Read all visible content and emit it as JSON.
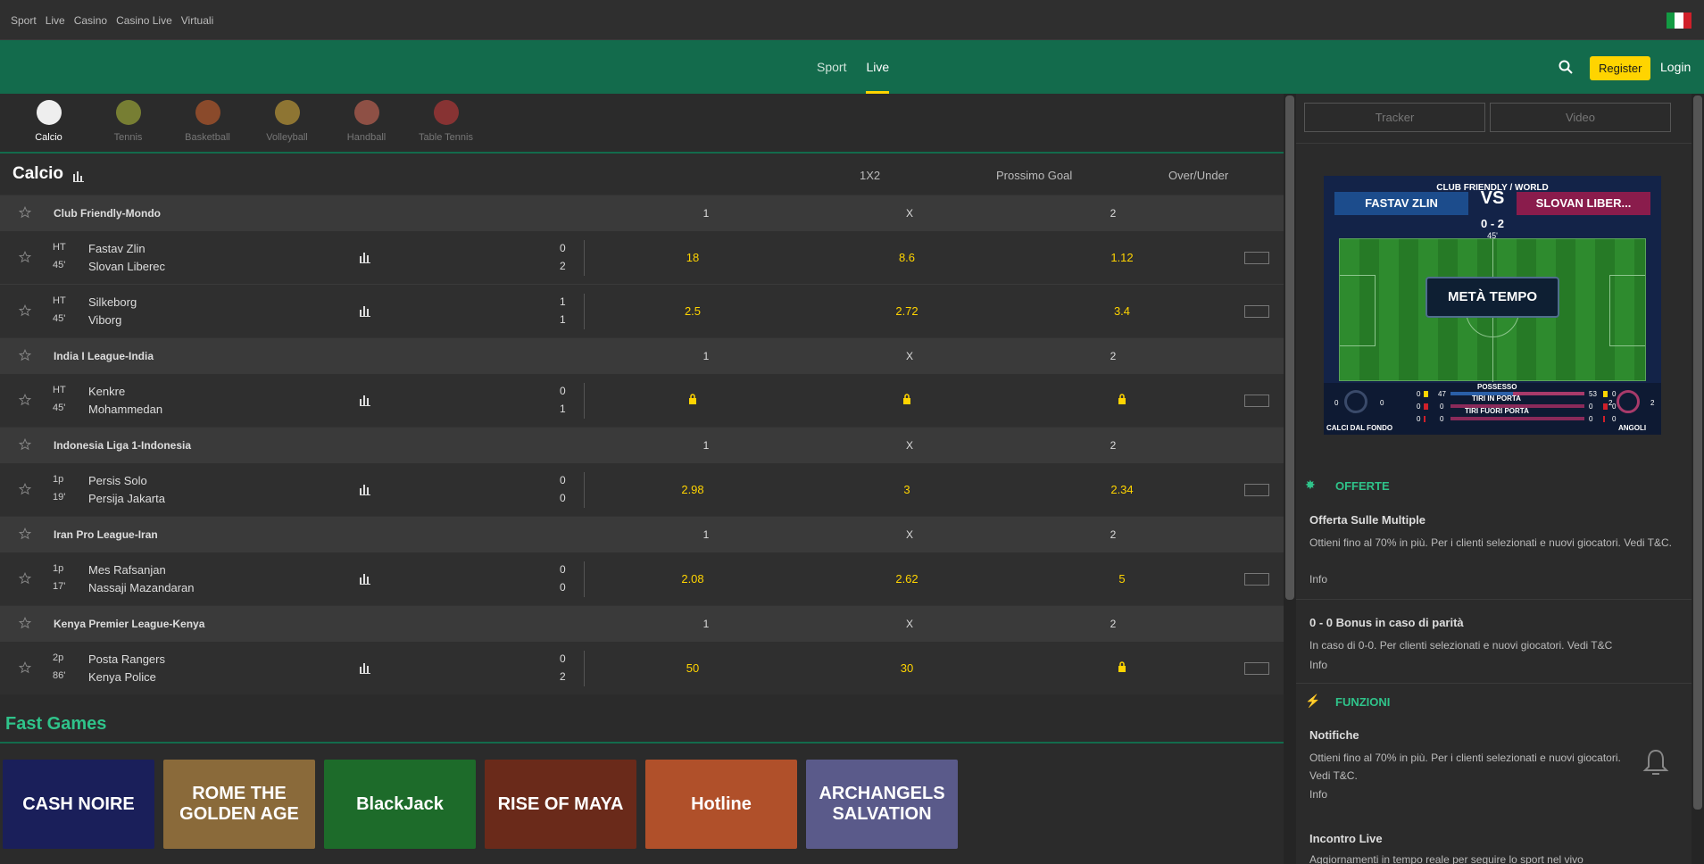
{
  "topbar": {
    "links": [
      "Sport",
      "Live",
      "Casino",
      "Casino Live",
      "Virtuali"
    ]
  },
  "header": {
    "nav": [
      "Sport",
      "Live"
    ],
    "active": "Live",
    "register": "Register",
    "login": "Login",
    "accent": "#ffd400",
    "brand": "#136b4c"
  },
  "sports": [
    {
      "label": "Calcio",
      "icon": "soccer-ball-icon",
      "color": "#eeeeee"
    },
    {
      "label": "Tennis",
      "icon": "tennis-ball-icon",
      "color": "#b7c23a"
    },
    {
      "label": "Basketball",
      "icon": "basketball-icon",
      "color": "#d9652b"
    },
    {
      "label": "Volleyball",
      "icon": "volleyball-icon",
      "color": "#e0b33a"
    },
    {
      "label": "Handball",
      "icon": "handball-icon",
      "color": "#e06f5b"
    },
    {
      "label": "Table Tennis",
      "icon": "table-tennis-icon",
      "color": "#d43a3a"
    }
  ],
  "calcio": {
    "title": "Calcio",
    "columns": [
      "1X2",
      "Prossimo Goal",
      "Over/Under"
    ]
  },
  "leagues": [
    {
      "name": "Club Friendly-Mondo",
      "h1": "1",
      "hx": "X",
      "h2": "2",
      "matches": [
        {
          "period": "HT",
          "time": "45'",
          "home": "Fastav Zlin",
          "away": "Slovan Liberec",
          "sh": "0",
          "sa": "2",
          "o1": "18",
          "ox": "8.6",
          "o2": "1.12"
        },
        {
          "period": "HT",
          "time": "45'",
          "home": "Silkeborg",
          "away": "Viborg",
          "sh": "1",
          "sa": "1",
          "o1": "2.5",
          "ox": "2.72",
          "o2": "3.4"
        }
      ]
    },
    {
      "name": "India I League-India",
      "h1": "1",
      "hx": "X",
      "h2": "2",
      "matches": [
        {
          "period": "HT",
          "time": "45'",
          "home": "Kenkre",
          "away": "Mohammedan",
          "sh": "0",
          "sa": "1",
          "o1": "lock",
          "ox": "lock",
          "o2": "lock"
        }
      ]
    },
    {
      "name": "Indonesia Liga 1-Indonesia",
      "h1": "1",
      "hx": "X",
      "h2": "2",
      "matches": [
        {
          "period": "1p",
          "time": "19'",
          "home": "Persis Solo",
          "away": "Persija Jakarta",
          "sh": "0",
          "sa": "0",
          "o1": "2.98",
          "ox": "3",
          "o2": "2.34"
        }
      ]
    },
    {
      "name": "Iran Pro League-Iran",
      "h1": "1",
      "hx": "X",
      "h2": "2",
      "matches": [
        {
          "period": "1p",
          "time": "17'",
          "home": "Mes Rafsanjan",
          "away": "Nassaji Mazandaran",
          "sh": "0",
          "sa": "0",
          "o1": "2.08",
          "ox": "2.62",
          "o2": "5"
        }
      ]
    },
    {
      "name": "Kenya Premier League-Kenya",
      "h1": "1",
      "hx": "X",
      "h2": "2",
      "matches": [
        {
          "period": "2p",
          "time": "86'",
          "home": "Posta Rangers",
          "away": "Kenya Police",
          "sh": "0",
          "sa": "2",
          "o1": "50",
          "ox": "30",
          "o2": "lock"
        }
      ]
    }
  ],
  "fast_games": {
    "title": "Fast Games",
    "games": [
      {
        "name": "CASH NOIRE",
        "bg": "#1a1f5a"
      },
      {
        "name": "ROME THE GOLDEN AGE",
        "bg": "#8a6a3a"
      },
      {
        "name": "BlackJack",
        "bg": "#1d6b2a"
      },
      {
        "name": "RISE OF MAYA",
        "bg": "#6a2a1a"
      },
      {
        "name": "Hotline",
        "bg": "#b0502a"
      },
      {
        "name": "ARCHANGELS SALVATION",
        "bg": "#5a5a8a"
      }
    ]
  },
  "side": {
    "tabs": [
      "Tracker",
      "Video"
    ],
    "tracker": {
      "title": "CLUB FRIENDLY / WORLD",
      "home": "FASTAV ZLIN",
      "away": "SLOVAN LIBER...",
      "vs": "VS",
      "score": "0 - 2",
      "minute": "45'",
      "status": "METÀ TEMPO",
      "possesso_label": "POSSESSO",
      "tiri_porta_label": "TIRI IN PORTA",
      "tiri_fuori_label": "TIRI FUORI PORTA",
      "calci_fondo_label": "CALCI DAL FONDO",
      "angoli_label": "ANGOLI",
      "possesso_home": "47",
      "possesso_away": "53",
      "tiri_porta_home": "0",
      "tiri_porta_away": "0",
      "tiri_fuori_home": "0",
      "tiri_fuori_away": "0",
      "calci_fondo_home": "0",
      "calci_fondo_away": "0",
      "angoli_home": "2",
      "angoli_away": "2",
      "yellow_home": "0",
      "yellow_away": "0",
      "red_home": "0",
      "red_away": "0",
      "sub_home": "0",
      "sub_away": "0"
    },
    "offerte": {
      "title": "OFFERTE",
      "items": [
        {
          "title": "Offerta Sulle Multiple",
          "text": "Ottieni fino al 70% in più. Per i clienti selezionati e nuovi giocatori. Vedi T&C.",
          "info": "Info"
        },
        {
          "title": "0 - 0 Bonus in caso di parità",
          "text": "In caso di 0-0. Per clienti selezionati e nuovi giocatori. Vedi T&C",
          "info": "Info"
        }
      ]
    },
    "funzioni": {
      "title": "FUNZIONI",
      "items": [
        {
          "title": "Notifiche",
          "text": "Ottieni fino al 70% in più. Per i clienti selezionati e nuovi giocatori. Vedi T&C.",
          "info": "Info"
        },
        {
          "title": "Incontro Live",
          "text": "Aggiornamenti in tempo reale per seguire lo sport nel vivo"
        }
      ]
    }
  }
}
